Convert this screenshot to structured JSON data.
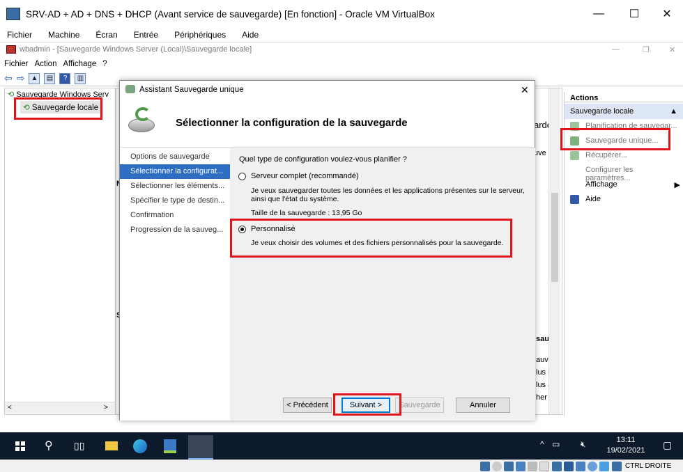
{
  "vbox": {
    "title": "SRV-AD + AD + DNS + DHCP (Avant service de sauvegarde) [En fonction] - Oracle VM VirtualBox",
    "menu": [
      "Fichier",
      "Machine",
      "Écran",
      "Entrée",
      "Périphériques",
      "Aide"
    ]
  },
  "wbadmin": {
    "title": "wbadmin - [Sauvegarde Windows Server (Local)\\Sauvegarde locale]",
    "menu": [
      "Fichier",
      "Action",
      "Affichage",
      "?"
    ]
  },
  "tree": {
    "root": "Sauvegarde Windows Serv",
    "child": "Sauvegarde locale"
  },
  "actions": {
    "header": "Actions",
    "section": "Sauvegarde locale",
    "items": [
      "Planification de sauvegar...",
      "Sauvegarde unique...",
      "Récupérer...",
      "Configurer les paramètres...",
      "Affichage",
      "Aide"
    ]
  },
  "midpane": {
    "frag1": "arde",
    "frag2": "uve",
    "frag3": "N",
    "frag4": "S",
    "frag5": "sau",
    "frag6": "auve",
    "frag7": "lus re",
    "frag8": "lus a",
    "frag9": "her l"
  },
  "dialog": {
    "title": "Assistant Sauvegarde unique",
    "heading": "Sélectionner la configuration de la sauvegarde",
    "nav": [
      "Options de sauvegarde",
      "Sélectionner la configurat...",
      "Sélectionner les éléments...",
      "Spécifier le type de destin...",
      "Confirmation",
      "Progression de la sauveg..."
    ],
    "question": "Quel type de configuration voulez-vous planifier ?",
    "opt1": {
      "label": "Serveur complet (recommandé)",
      "desc1": "Je veux sauvegarder toutes les données et les applications présentes sur le serveur,",
      "desc2": "ainsi que l'état du système.",
      "size": "Taille de la sauvegarde : 13,95 Go"
    },
    "opt2": {
      "label": "Personnalisé",
      "desc": "Je veux choisir des volumes et des fichiers personnalisés pour la sauvegarde."
    },
    "buttons": {
      "prev": "< Précédent",
      "next": "Suivant >",
      "backup": "Sauvegarde",
      "cancel": "Annuler"
    }
  },
  "taskbar": {
    "time": "13:11",
    "date": "19/02/2021"
  },
  "status": {
    "host_key": "CTRL DROITE"
  }
}
